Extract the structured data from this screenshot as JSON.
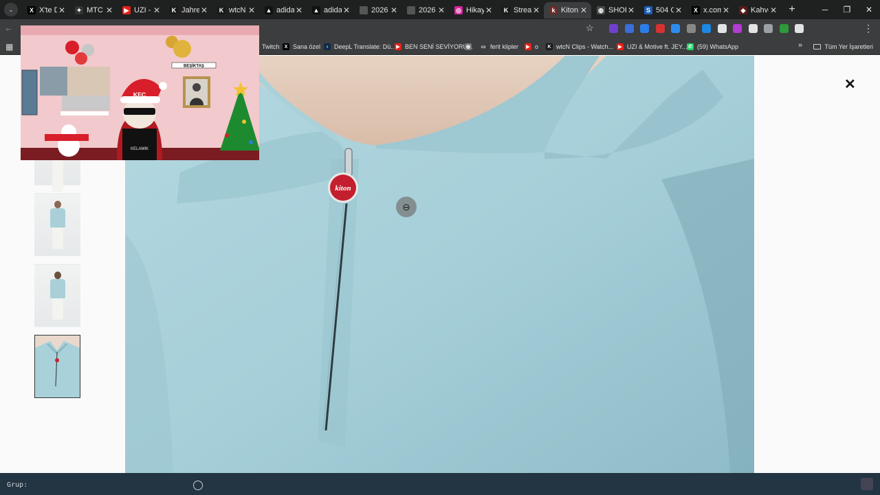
{
  "tabs": [
    {
      "title": "X'te D",
      "favicon": "x-icon",
      "color": "#000000",
      "glyph": "X"
    },
    {
      "title": "MTC T",
      "favicon": "mtc-icon",
      "color": "#333333",
      "glyph": "✦"
    },
    {
      "title": "UZI - I",
      "favicon": "youtube-icon",
      "color": "#e62117",
      "glyph": "▶"
    },
    {
      "title": "Jahre",
      "favicon": "kick-icon",
      "color": "#1a1a1a",
      "glyph": "K"
    },
    {
      "title": "wtcN",
      "favicon": "kick-icon",
      "color": "#1a1a1a",
      "glyph": "K"
    },
    {
      "title": "adidas",
      "favicon": "adidas-icon",
      "color": "#111111",
      "glyph": "▲"
    },
    {
      "title": "adida",
      "favicon": "adidas-icon",
      "color": "#111111",
      "glyph": "▲"
    },
    {
      "title": "2026",
      "favicon": "blank-icon",
      "color": "#555555",
      "glyph": ""
    },
    {
      "title": "2026",
      "favicon": "blank-icon",
      "color": "#555555",
      "glyph": ""
    },
    {
      "title": "Hikay",
      "favicon": "instagram-icon",
      "color": "#d6249f",
      "glyph": "◎"
    },
    {
      "title": "Strear",
      "favicon": "kick-icon",
      "color": "#1a1a1a",
      "glyph": "K"
    },
    {
      "title": "Kiton",
      "favicon": "kiton-icon",
      "color": "#6b2b2b",
      "glyph": "k",
      "active": true
    },
    {
      "title": "SHOR",
      "favicon": "globe-icon",
      "color": "#4a4a4a",
      "glyph": "◍"
    },
    {
      "title": "504 G",
      "favicon": "s-icon",
      "color": "#1c5db8",
      "glyph": "S"
    },
    {
      "title": "x.com",
      "favicon": "x-icon",
      "color": "#000000",
      "glyph": "X"
    },
    {
      "title": "Kahve",
      "favicon": "diamond-icon",
      "color": "#5a1a1a",
      "glyph": "◆"
    }
  ],
  "bookmarks": [
    {
      "label": "Twitch",
      "icon": "twitch-icon",
      "color": "#9146ff",
      "glyph": "▮"
    },
    {
      "label": "Sana özel",
      "icon": "x-icon",
      "color": "#000000",
      "glyph": "X"
    },
    {
      "label": "DeepL Translate: Dü...",
      "icon": "deepl-icon",
      "color": "#0f2b46",
      "glyph": "›"
    },
    {
      "label": "BEN SENİ SEVİYORU...",
      "icon": "youtube-icon",
      "color": "#e62117",
      "glyph": "▶"
    },
    {
      "label": "",
      "icon": "globe-icon",
      "color": "#777777",
      "glyph": "◍"
    },
    {
      "label": "ferit klipler",
      "icon": "folder-icon",
      "color": "#3c3d3e",
      "glyph": "▭"
    },
    {
      "label": "o",
      "icon": "youtube-icon",
      "color": "#e62117",
      "glyph": "▶"
    },
    {
      "label": "wtcN Clips - Watch...",
      "icon": "kick-icon",
      "color": "#1a1a1a",
      "glyph": "K"
    },
    {
      "label": "UZI & Motive ft. JEY...",
      "icon": "youtube-icon",
      "color": "#e62117",
      "glyph": "▶"
    },
    {
      "label": "(59) WhatsApp",
      "icon": "whatsapp-icon",
      "color": "#25d366",
      "glyph": "✆"
    }
  ],
  "all_bookmarks_label": "Tüm Yer İşaretleri",
  "extensions": [
    "#6f3fd1",
    "#3a6ed8",
    "#2b7de9",
    "#d43232",
    "#2d8cf0",
    "#888888",
    "#1e88e5",
    "#e3e3e3",
    "#b23bd2",
    "#e3e3e3",
    "#9aa0a6",
    "#2e9a3a",
    "#e3e3e3"
  ],
  "bottom_bar": {
    "label": "Grup:"
  },
  "overlay": {
    "banner_text": "BEŞİKTAŞ",
    "hat_text": "KFC",
    "chain_text": "KELAMIK"
  },
  "product": {
    "zipper_pull_text": "kiton"
  }
}
